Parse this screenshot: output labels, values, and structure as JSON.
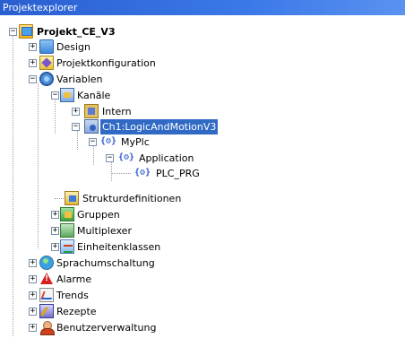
{
  "panel": {
    "title": "Projektexplorer"
  },
  "tree": {
    "root": {
      "label": "Projekt_CE_V3",
      "icon": "project-icon",
      "expander": "−"
    },
    "items": [
      {
        "label": "Design",
        "icon": "folder-icon",
        "expander": "+"
      },
      {
        "label": "Projektkonfiguration",
        "icon": "config-icon",
        "expander": "+"
      },
      {
        "label": "Variablen",
        "icon": "variables-icon",
        "expander": "−"
      },
      {
        "label": "Kanäle",
        "icon": "channels-icon",
        "expander": "−"
      },
      {
        "label": "Intern",
        "icon": "intern-icon",
        "expander": "+"
      },
      {
        "label": "Ch1:LogicAndMotionV3",
        "icon": "channel-icon",
        "expander": "−",
        "selected": true
      },
      {
        "label": "MyPlc",
        "icon": "curly-braces-icon",
        "expander": "−"
      },
      {
        "label": "Application",
        "icon": "curly-braces-icon",
        "expander": "−"
      },
      {
        "label": "PLC_PRG",
        "icon": "curly-braces-icon"
      },
      {
        "label": "Strukturdefinitionen",
        "icon": "structure-icon"
      },
      {
        "label": "Gruppen",
        "icon": "groups-icon",
        "expander": "+"
      },
      {
        "label": "Multiplexer",
        "icon": "multiplexer-icon",
        "expander": "+"
      },
      {
        "label": "Einheitenklassen",
        "icon": "unit-classes-icon",
        "expander": "+"
      },
      {
        "label": "Sprachumschaltung",
        "icon": "globe-icon",
        "expander": "+"
      },
      {
        "label": "Alarme",
        "icon": "alarm-icon",
        "expander": "+"
      },
      {
        "label": "Trends",
        "icon": "trend-icon",
        "expander": "+"
      },
      {
        "label": "Rezepte",
        "icon": "recipe-icon",
        "expander": "+"
      },
      {
        "label": "Benutzerverwaltung",
        "icon": "user-icon",
        "expander": "+"
      }
    ],
    "curly_glyph": "{⚙}"
  }
}
